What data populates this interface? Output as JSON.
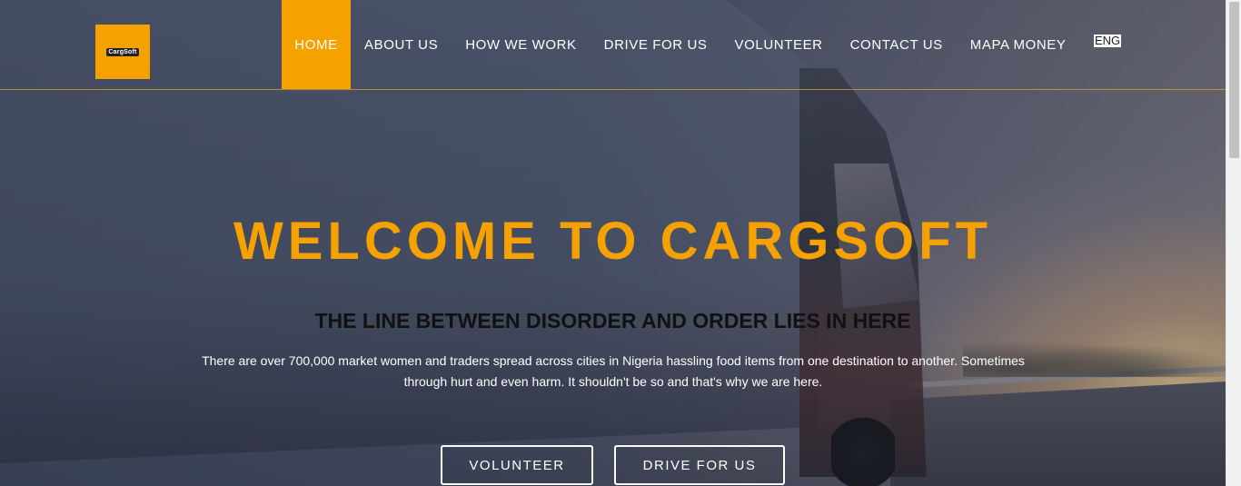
{
  "brand": {
    "logo_text": "CargSoft",
    "accent_color": "#f5a100"
  },
  "nav": {
    "items": [
      {
        "label": "HOME",
        "active": true
      },
      {
        "label": "ABOUT US"
      },
      {
        "label": "HOW WE WORK"
      },
      {
        "label": "DRIVE FOR US"
      },
      {
        "label": "VOLUNTEER"
      },
      {
        "label": "CONTACT US"
      },
      {
        "label": "MAPA MONEY"
      }
    ],
    "language": "ENG"
  },
  "hero": {
    "title": "WELCOME TO CARGSOFT",
    "subtitle": "THE LINE BETWEEN DISORDER AND ORDER LIES IN HERE",
    "description": "There are over 700,000 market women and traders spread across cities in Nigeria hassling food items from one destination to another. Sometimes through hurt and even harm. It shouldn't be so and that's why we are here.",
    "buttons": {
      "volunteer": "VOLUNTEER",
      "drive": "DRIVE FOR US"
    }
  }
}
